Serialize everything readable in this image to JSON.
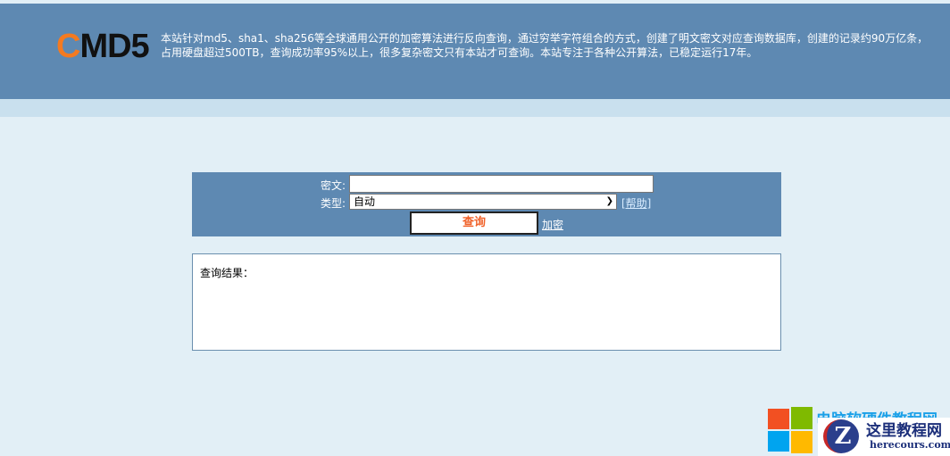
{
  "header": {
    "logo": {
      "c": "C",
      "rest": "MD5"
    },
    "intro_line1": "本站针对md5、sha1、sha256等全球通用公开的加密算法进行反向查询，通过穷举字符组合的方式，创建了明文密文对应查询数据库，创建的记录约90万亿条，",
    "intro_line2": "占用硬盘超过500TB，查询成功率95%以上，很多复杂密文只有本站才可查询。本站专注于各种公开算法，已稳定运行17年。"
  },
  "form": {
    "cipher_label": "密文:",
    "cipher_value": "",
    "type_label": "类型:",
    "type_selected": "自动",
    "help_link": "[帮助]",
    "query_button": "查询",
    "encrypt_link": "加密"
  },
  "result": {
    "label": "查询结果："
  },
  "watermark": {
    "site_title": "电脑软硬件教程网",
    "brand": "这里教程网",
    "domain": "herecours.com"
  }
}
